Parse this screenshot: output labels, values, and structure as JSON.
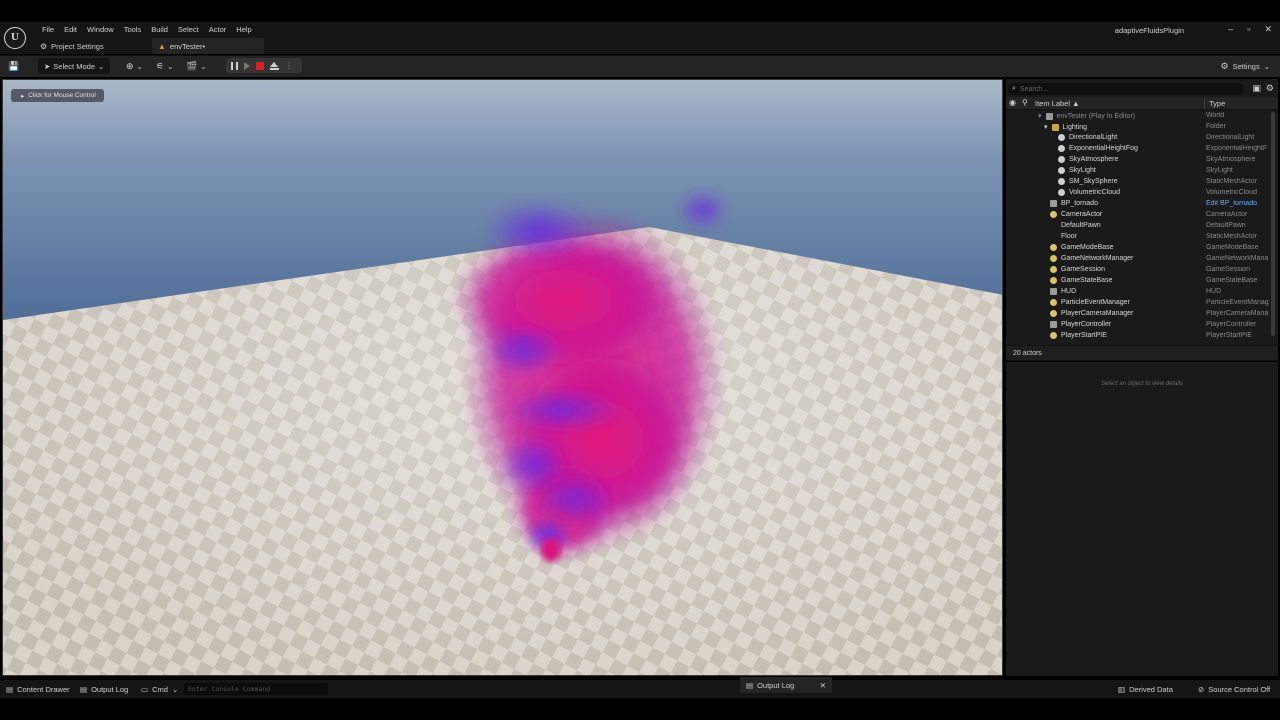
{
  "window": {
    "plugin_title": "adaptiveFluidsPlugin",
    "controls": [
      "–",
      "▫",
      "✕"
    ]
  },
  "menu": [
    "File",
    "Edit",
    "Window",
    "Tools",
    "Build",
    "Select",
    "Actor",
    "Help"
  ],
  "tabs": [
    {
      "label": "Project Settings"
    },
    {
      "label": "envTester•"
    }
  ],
  "toolbar": {
    "select_mode": "Select Mode",
    "settings": "Settings"
  },
  "viewport": {
    "mouse_control_hint": "Click for Mouse Control"
  },
  "outliner": {
    "search_placeholder": "Search...",
    "col_label": "Item Label ▲",
    "col_type": "Type",
    "rows": [
      {
        "name": "envTester (Play In Editor)",
        "type": "World"
      },
      {
        "name": "Lighting",
        "type": "Folder"
      },
      {
        "name": "DirectionalLight",
        "type": "DirectionalLight"
      },
      {
        "name": "ExponentialHeightFog",
        "type": "ExponentialHeightF"
      },
      {
        "name": "SkyAtmosphere",
        "type": "SkyAtmosphere"
      },
      {
        "name": "SkyLight",
        "type": "SkyLight"
      },
      {
        "name": "SM_SkySphere",
        "type": "StaticMeshActor"
      },
      {
        "name": "VolumetricCloud",
        "type": "VolumetricCloud"
      },
      {
        "name": "BP_tornado",
        "type": "Edit BP_tornado"
      },
      {
        "name": "CameraActor",
        "type": "CameraActor"
      },
      {
        "name": "DefaultPawn",
        "type": "DefaultPawn"
      },
      {
        "name": "Floor",
        "type": "StaticMeshActor"
      },
      {
        "name": "GameModeBase",
        "type": "GameModeBase"
      },
      {
        "name": "GameNetworkManager",
        "type": "GameNetworkMana"
      },
      {
        "name": "GameSession",
        "type": "GameSession"
      },
      {
        "name": "GameStateBase",
        "type": "GameStateBase"
      },
      {
        "name": "HUD",
        "type": "HUD"
      },
      {
        "name": "ParticleEventManager",
        "type": "ParticleEventManag"
      },
      {
        "name": "PlayerCameraManager",
        "type": "PlayerCameraMana"
      },
      {
        "name": "PlayerController",
        "type": "PlayerController"
      },
      {
        "name": "PlayerStartPIE",
        "type": "PlayerStartPIE"
      }
    ],
    "actor_count": "20 actors"
  },
  "details": {
    "hint": "Select an object to view details"
  },
  "statusbar": {
    "content_drawer": "Content Drawer",
    "output_log": "Output Log",
    "cmd": "Cmd",
    "console_placeholder": "Enter Console Command",
    "output_log_tab": "Output Log",
    "derived_data": "Derived Data",
    "source_control": "Source Control Off"
  },
  "colors": {
    "accent_blue": "#6fa8ff",
    "stop_red": "#e02020",
    "tornado_magenta": "#e0207a",
    "tornado_purple": "#7a2fe0"
  }
}
